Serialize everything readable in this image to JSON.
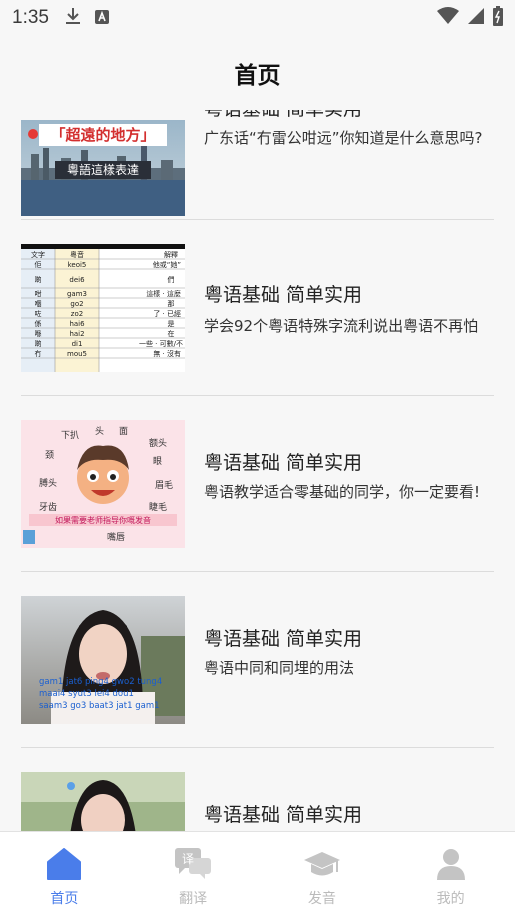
{
  "status_bar": {
    "time": "1:35"
  },
  "header": {
    "title": "首页"
  },
  "feed": [
    {
      "title": "粤语基础 简单实用",
      "desc": "广东话“冇雷公咁远”你知道是什么意思吗?",
      "thumb_text": [
        "「超遠的地方」",
        "粵語這樣表達"
      ]
    },
    {
      "title": "粤语基础 简单实用",
      "desc": "学会92个粤语特殊字流利说出粤语不再怕",
      "thumb_table": {
        "headers": [
          "文字",
          "粵音",
          "解釋"
        ],
        "rows": [
          [
            "佢",
            "keoi5",
            "他或“她”"
          ],
          [
            "啲",
            "dei6",
            "們"
          ],
          [
            "咁",
            "gam3",
            "這樣 · 這麼"
          ],
          [
            "嗰",
            "go2",
            "那"
          ],
          [
            "咗",
            "zo2",
            "了 · 已經"
          ],
          [
            "係",
            "hai6",
            "是"
          ],
          [
            "喺",
            "hai2",
            "在"
          ],
          [
            "啲",
            "di1",
            "一些 · 可數/不"
          ],
          [
            "冇",
            "mou5",
            "無 · 沒有"
          ]
        ]
      }
    },
    {
      "title": "粤语基础 简单实用",
      "desc": "粤语教学适合零基础的同学，你一定要看!",
      "thumb_text": [
        "如果需要老师指导你嘅发音"
      ]
    },
    {
      "title": "粤语基础 简单实用",
      "desc": "粤语中同和同埋的用法",
      "thumb_text": [
        "gam1 jat6 ping4 gwo2 tung4",
        "maai4 syut3 lei4 dou1",
        "saam3 go3 baat3 jat1 gam1"
      ]
    },
    {
      "title": "粤语基础 简单实用",
      "desc": ""
    }
  ],
  "tabbar": {
    "tabs": [
      {
        "label": "首页",
        "icon": "home-icon",
        "active": true
      },
      {
        "label": "翻译",
        "icon": "translate-icon",
        "active": false
      },
      {
        "label": "发音",
        "icon": "graduation-cap-icon",
        "active": false
      },
      {
        "label": "我的",
        "icon": "user-icon",
        "active": false
      }
    ],
    "active_color": "#4a7dea",
    "inactive_color": "#bbbbbb"
  }
}
